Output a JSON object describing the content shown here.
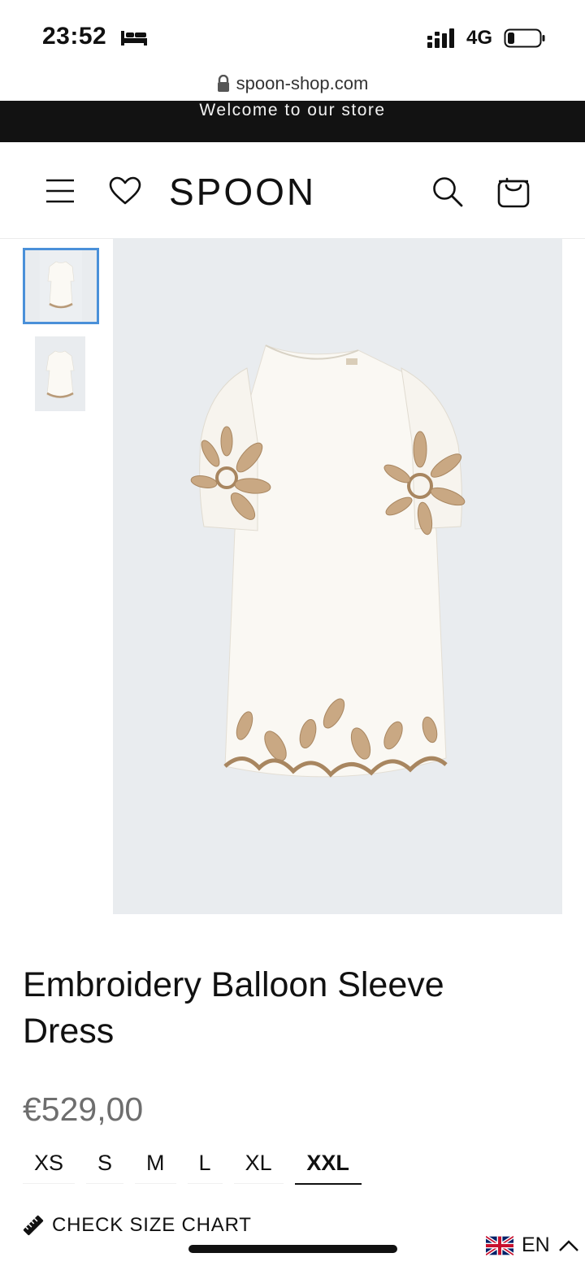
{
  "status_bar": {
    "time": "23:52",
    "network": "4G",
    "icons": [
      "bed-icon",
      "signal-icon",
      "battery-icon"
    ]
  },
  "browser": {
    "url": "spoon-shop.com",
    "lock_icon": "lock-icon"
  },
  "announcement": {
    "text": "Welcome to our store",
    "background": "#121212"
  },
  "header": {
    "logo": "SPOON",
    "icons": [
      "menu-icon",
      "heart-icon",
      "search-icon",
      "cart-icon"
    ]
  },
  "gallery": {
    "thumbnails": 2,
    "selected_index": 0,
    "selected_color": "#4a90d9",
    "background": "#e9ecef"
  },
  "product": {
    "title": "Embroidery Balloon Sleeve Dress",
    "price": "€529,00",
    "sizes": [
      "XS",
      "S",
      "M",
      "L",
      "XL",
      "XXL"
    ],
    "selected_size": "XXL",
    "size_chart_label": "CHECK SIZE CHART"
  },
  "language": {
    "code": "EN",
    "flag_icon": "uk-flag-icon"
  }
}
